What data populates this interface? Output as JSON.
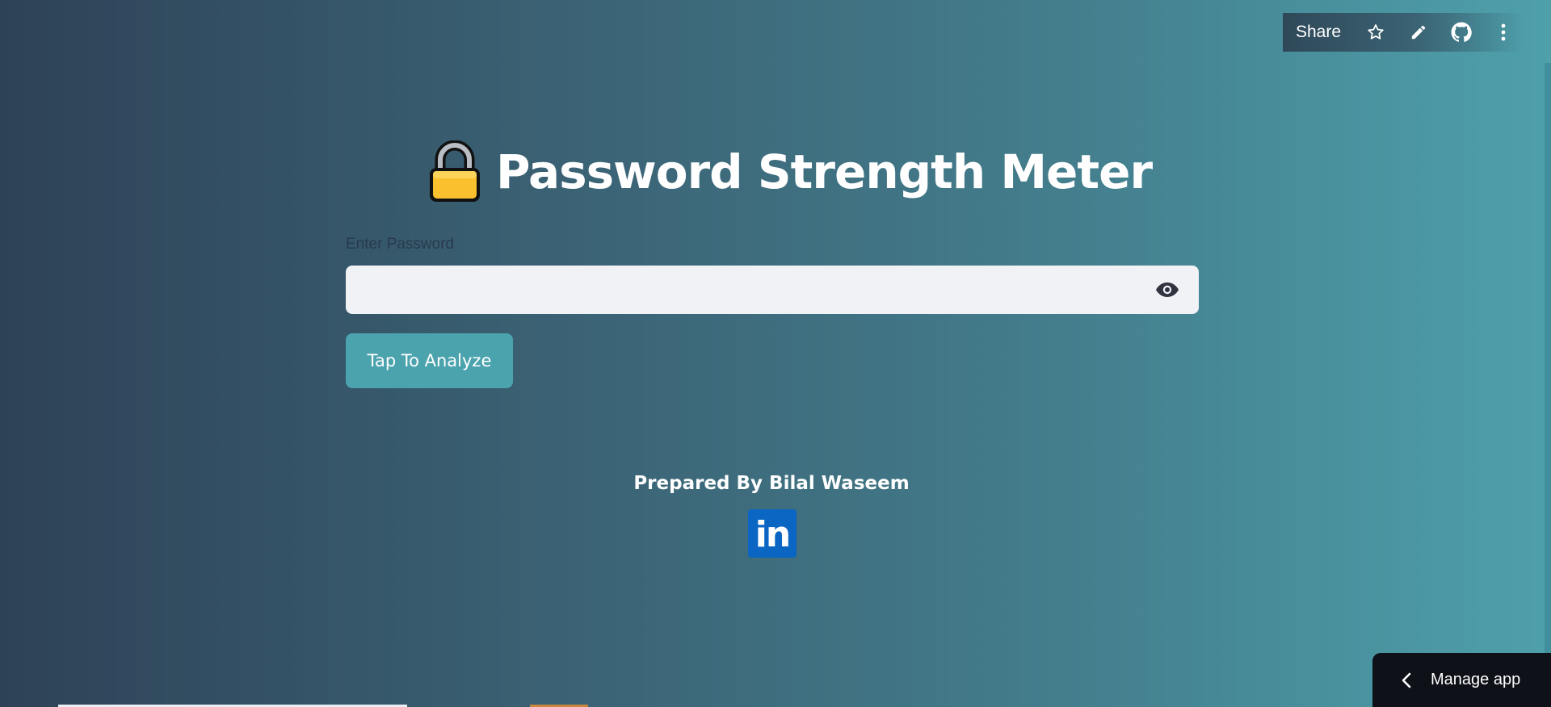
{
  "toolbar": {
    "share_label": "Share",
    "icons": [
      "star-icon",
      "pencil-icon",
      "github-icon",
      "more-vertical-icon"
    ]
  },
  "main": {
    "title_icon": "lock-icon",
    "title": "Password Strength Meter",
    "password_label": "Enter Password",
    "password_value": "",
    "password_placeholder": "",
    "analyze_button": "Tap To Analyze",
    "credit": "Prepared By Bilal Waseem",
    "linkedin_text": "in"
  },
  "manage_app": {
    "label": "Manage app"
  },
  "colors": {
    "background_start": "#2e4257",
    "background_end": "#4ea0ab",
    "button_bg": "#4ba3ad",
    "input_bg": "#f0f2f6",
    "linkedin_blue": "#0a66c2",
    "manage_bg": "#0e1117"
  }
}
